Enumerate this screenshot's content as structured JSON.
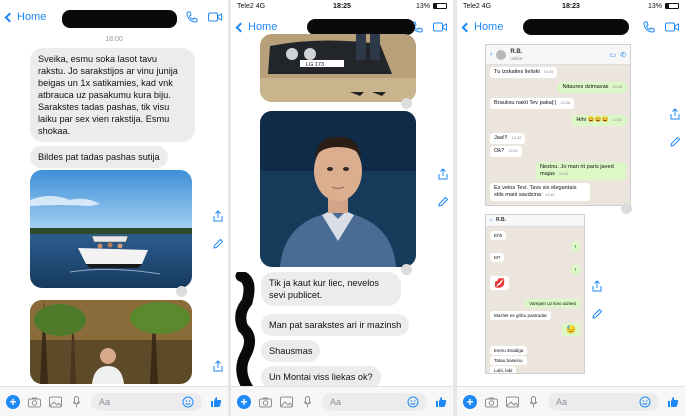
{
  "panel1": {
    "nav": {
      "back_label": "Home"
    },
    "timestamp": "18:00",
    "messages": [
      "Sveika, esmu soka lasot tavu rakstu. Jo sarakstijos ar vinu junija beigas un 1x satikamies, kad vnk atbrauca uz pasakumu kura biju. Sarakstes tadas pashas, tik visu laiku par sex vien rakstija. Esmu shokaa.",
      "Bildes pat tadas pashas sutija"
    ],
    "composer": {
      "placeholder": "Aa"
    }
  },
  "panel2": {
    "status": {
      "carrier": "Tele2",
      "network": "4G",
      "time": "18:25",
      "battery": "13%"
    },
    "nav": {
      "back_label": "Home"
    },
    "plate_fragment": "LG 173",
    "messages": [
      "Tik ja kaut kur liec, nevelos sevi publicet.",
      "Man pat sarakstes ari ir mazinsh",
      "Shausmas",
      "Un Montai viss liekas ok?"
    ],
    "composer": {
      "placeholder": "Aa"
    }
  },
  "panel3": {
    "status": {
      "carrier": "Tele2",
      "network": "4G",
      "time": "18:23",
      "battery": "13%"
    },
    "nav": {
      "back_label": "Home"
    },
    "wa1": {
      "contact": "R.B.",
      "sub": "online",
      "messages": [
        {
          "dir": "in",
          "text": "Tu izskaties lieliski",
          "time": "13:35"
        },
        {
          "dir": "out",
          "text": "Nitaures dzimavas",
          "time": "13:36"
        },
        {
          "dir": "in",
          "text": "Brauksu nakti Tev pakaļ:)",
          "time": "13:38"
        },
        {
          "dir": "out",
          "text": "Hihi 😄😄😄",
          "time": "13:40"
        },
        {
          "dir": "in",
          "text": "Jaa!!!",
          "time": "13:42"
        },
        {
          "dir": "in",
          "text": "Ok?",
          "time": "13:42"
        },
        {
          "dir": "out",
          "text": "Nezinu. Jo man rit paris javed majas",
          "time": "13:43"
        },
        {
          "dir": "in",
          "text": "Es velos Tevi. Tavs sis elegantais stils mani savdzina",
          "time": "13:45"
        }
      ]
    },
    "wa2": {
      "contact": "R.B.",
      "messages": [
        {
          "dir": "in",
          "text": "Ehh",
          "time": ""
        },
        {
          "dir": "out",
          "text": "!",
          "time": ""
        },
        {
          "dir": "in",
          "text": "M?",
          "time": ""
        },
        {
          "dir": "out",
          "text": "!",
          "time": ""
        },
        {
          "dir": "in",
          "text": "💋",
          "time": ""
        },
        {
          "dir": "out",
          "text": "Varejam uz kino aiziest",
          "time": ""
        },
        {
          "dir": "in",
          "text": "Mazliet es gribu pastradat",
          "time": ""
        },
        {
          "dir": "out",
          "text": "😓",
          "time": ""
        },
        {
          "dir": "in",
          "text": "Esmu stradiga",
          "time": ""
        },
        {
          "dir": "in",
          "text": "Tatau baseinu",
          "time": ""
        },
        {
          "dir": "in",
          "text": "Labi, labi",
          "time": ""
        }
      ]
    },
    "composer": {
      "placeholder": "Aa"
    }
  },
  "colors": {
    "accent": "#1e88f5",
    "bubble_in": "#ececed",
    "wa_out": "#dcf8c6",
    "wa_bg": "#ece5dd"
  }
}
